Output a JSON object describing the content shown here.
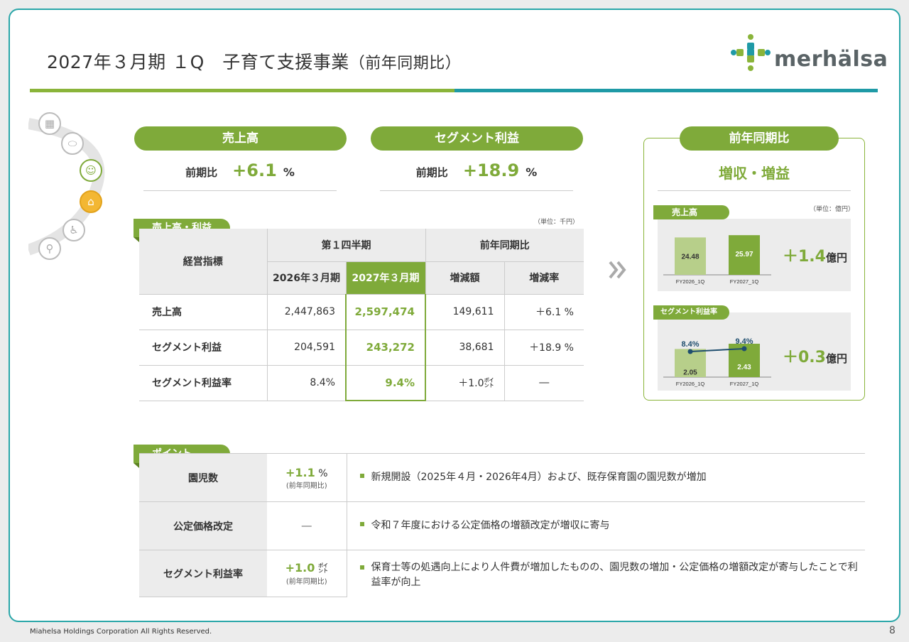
{
  "header": {
    "title_main": "2027年３月期 １Q　子育て支援事業",
    "title_sub": "（前年同期比）",
    "logo": "merhälsa"
  },
  "kpi": {
    "sales": {
      "label": "売上高",
      "compare_label": "前期比",
      "value": "+6.1",
      "unit": "%"
    },
    "profit": {
      "label": "セグメント利益",
      "compare_label": "前期比",
      "value": "+18.9",
      "unit": "%"
    }
  },
  "table": {
    "tab_label": "売上高・利益",
    "unit_note": "（単位：千円）",
    "head": {
      "indicator": "経営指標",
      "q1": "第１四半期",
      "yoy": "前年同期比",
      "fy2026": "2026年３月期",
      "fy2027": "2027年３月期",
      "change_amount": "増減額",
      "change_rate": "増減率"
    },
    "rows": [
      {
        "label": "売上高",
        "fy2026": "2,447,863",
        "fy2027": "2,597,474",
        "amount": "149,611",
        "rate": "＋6.1 %"
      },
      {
        "label": "セグメント利益",
        "fy2026": "204,591",
        "fy2027": "243,272",
        "amount": "38,681",
        "rate": "＋18.9 %"
      },
      {
        "label": "セグメント利益率",
        "fy2026": "8.4%",
        "fy2027": "9.4%",
        "amount": "＋1.0㌽",
        "rate": "―"
      }
    ]
  },
  "panel": {
    "title": "前年同期比",
    "headline": "増収・増益",
    "unit_note": "（単位：億円）",
    "sales_tab": "売上高",
    "margin_tab": "セグメント利益率",
    "sales_delta_value": "＋1.4",
    "delta_unit": "億円",
    "profit_delta_value": "＋0.3"
  },
  "chart_data": [
    {
      "type": "bar",
      "title": "売上高",
      "categories": [
        "FY2026_1Q",
        "FY2027_1Q"
      ],
      "values": [
        24.48,
        25.97
      ],
      "labels": [
        "24.48",
        "25.97"
      ],
      "colors": [
        "#b7cf8a",
        "#7faa3a"
      ]
    },
    {
      "type": "bar",
      "title": "セグメント利益率",
      "categories": [
        "FY2026_1Q",
        "FY2027_1Q"
      ],
      "values": [
        2.05,
        2.43
      ],
      "labels": [
        "2.05",
        "2.43"
      ],
      "line": {
        "values": [
          8.4,
          9.4
        ],
        "labels": [
          "8.4%",
          "9.4%"
        ],
        "color": "#1f4e6e"
      },
      "colors": [
        "#b7cf8a",
        "#7faa3a"
      ]
    }
  ],
  "points": {
    "tab_label": "ポイント",
    "rows": [
      {
        "label": "園児数",
        "value": "+1.1",
        "unit": "%",
        "note": "(前年同期比)",
        "desc": "新規開設（2025年４月・2026年4月）および、既存保育園の園児数が増加"
      },
      {
        "label": "公定価格改定",
        "value": "―",
        "unit": "",
        "note": "",
        "desc": "令和７年度における公定価格の増額改定が増収に寄与"
      },
      {
        "label": "セグメント利益率",
        "value": "+1.0",
        "unit": "㌽",
        "note": "(前年同期比)",
        "desc": "保育士等の処遇向上により人件費が増加したものの、園児数の増加・公定価格の増額改定が寄与したことで利益率が向上"
      }
    ]
  },
  "footer": {
    "copyright": "Miahelsa Holdings Corporation All Rights Reserved.",
    "page": "8"
  },
  "colors": {
    "green": "#7faa3a",
    "light_green": "#b7cf8a",
    "teal": "#1f9aa6",
    "navy": "#1f4e6e"
  }
}
